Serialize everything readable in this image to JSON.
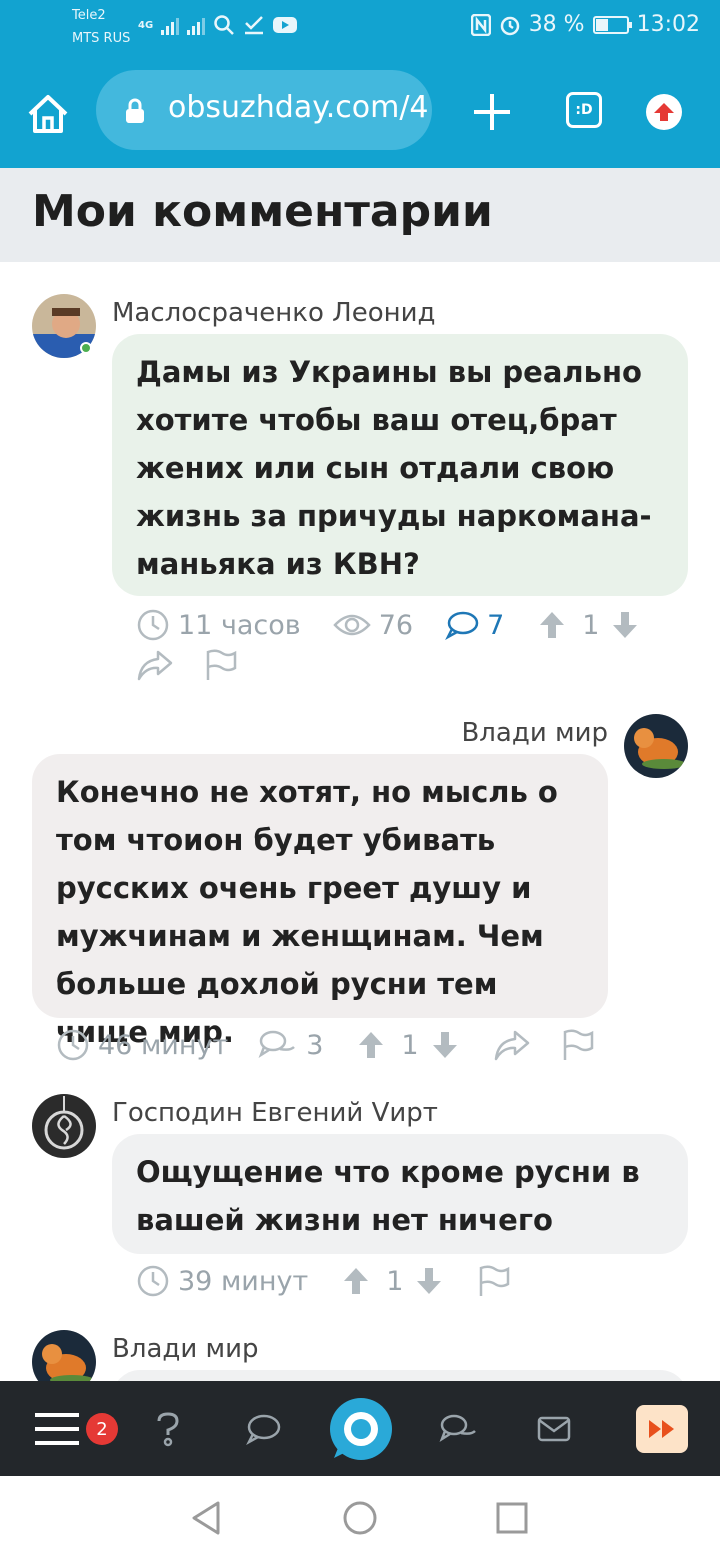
{
  "status_bar": {
    "carrier_1": "Tele2",
    "carrier_2": "MTS RUS",
    "network_type": "4G",
    "battery_percent": "38 %",
    "battery_level": 0.38,
    "time": "13:02"
  },
  "browser": {
    "url": "obsuzhday.com/4",
    "tab_button_label": ":D"
  },
  "page": {
    "title": "Мои комментарии"
  },
  "comments": [
    {
      "author": "Маслосраченко Леонид",
      "text": "Дамы из Украины вы реально хотите чтобы ваш отец,брат жених или сын отдали свою жизнь за причуды наркомана-маньяка из КВН?",
      "time": "11 часов",
      "views": "76",
      "replies": "7",
      "rating": "1"
    },
    {
      "author": "Влади мир",
      "text": "Конечно не хотят, но мысль о том чтоион будет убивать русских очень греет душу и мужчинам и женщинам. Чем больше дохлой русни тем чище мир.",
      "time": "46 минут",
      "replies": "3",
      "rating": "1"
    },
    {
      "author": "Господин Евгений Vирт",
      "text": "Ощущение что кроме русни в вашей жизни нет ничего",
      "time": "39 минут",
      "rating": "1"
    },
    {
      "author": "Влади мир"
    }
  ],
  "app_nav": {
    "menu_badge": "2"
  },
  "colors": {
    "brand": "#12a3d0",
    "bubble_own": "#e9f2ea",
    "bubble_other": "#f1eeee",
    "bubble_neutral": "#f0f1f2",
    "nav_bg": "#23272b"
  }
}
